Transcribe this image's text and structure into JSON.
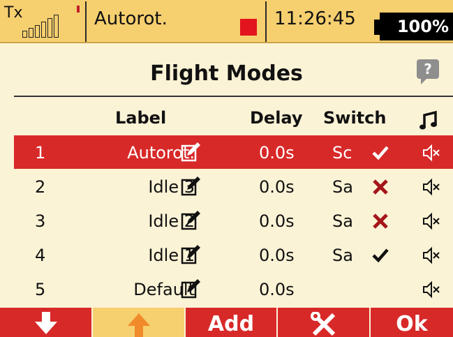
{
  "status_bar": {
    "tx_label": "Tx",
    "mode": "Autorot.",
    "time": "11:26:45",
    "battery": "100%"
  },
  "title": "Flight Modes",
  "table": {
    "headers": {
      "label": "Label",
      "delay": "Delay",
      "switch": "Switch",
      "sound_icon": "music-note-icon"
    },
    "rows": [
      {
        "num": "1",
        "label": "Autorot.",
        "delay": "0.0s",
        "switch": "Sc",
        "switch_state": "check",
        "selected": true
      },
      {
        "num": "2",
        "label": "Idle 3",
        "delay": "0.0s",
        "switch": "Sa",
        "switch_state": "cross",
        "selected": false
      },
      {
        "num": "3",
        "label": "Idle 2",
        "delay": "0.0s",
        "switch": "Sa",
        "switch_state": "cross",
        "selected": false
      },
      {
        "num": "4",
        "label": "Idle 1",
        "delay": "0.0s",
        "switch": "Sa",
        "switch_state": "check",
        "selected": false
      },
      {
        "num": "5",
        "label": "Default",
        "delay": "0.0s",
        "switch": "",
        "switch_state": "none",
        "selected": false
      }
    ]
  },
  "buttons": {
    "down_icon": "arrow-down-icon",
    "up_icon": "arrow-up-icon",
    "add": "Add",
    "tools_icon": "wrench-screwdriver-icon",
    "ok": "Ok"
  },
  "colors": {
    "status_bar_bg": "#f6cf6f",
    "page_bg": "#fbf3d6",
    "selected_row": "#d82929",
    "button_red": "#d82929",
    "button_highlight": "#f6cf6f",
    "cross_red": "#a4161a",
    "record_red": "#e2141d"
  }
}
